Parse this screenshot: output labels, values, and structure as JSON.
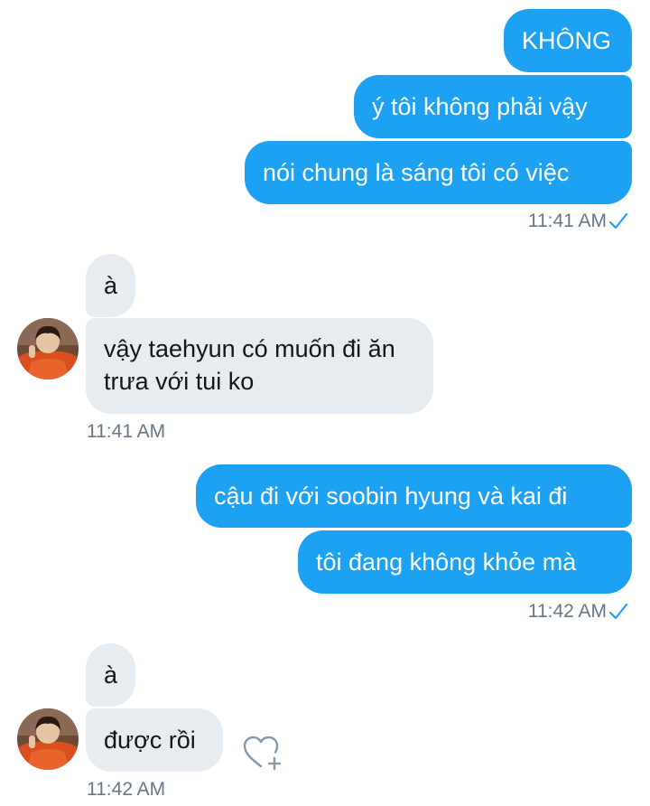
{
  "conversation": {
    "group1": {
      "messages": [
        "KHÔNG",
        "ý tôi không phải vậy",
        "nói chung là sáng tôi có việc"
      ],
      "time": "11:41 AM"
    },
    "group2": {
      "messages": [
        "à",
        "vậy taehyun có muốn đi ăn trưa với tui ko"
      ],
      "time": "11:41 AM"
    },
    "group3": {
      "messages": [
        "cậu đi với soobin hyung và kai đi",
        "tôi đang không khỏe mà"
      ],
      "time": "11:42 AM"
    },
    "group4": {
      "messages": [
        "à",
        "được rồi"
      ],
      "time": "11:42 AM"
    }
  },
  "colors": {
    "outgoing_bubble": "#1da1f2",
    "incoming_bubble": "#e6ecf0",
    "timestamp": "#657786",
    "read_check": "#1da1f2",
    "heart_outline": "#8899a6"
  },
  "icons": {
    "read_receipt": "check-icon",
    "like": "heart-plus-icon",
    "avatar": "user-avatar"
  }
}
